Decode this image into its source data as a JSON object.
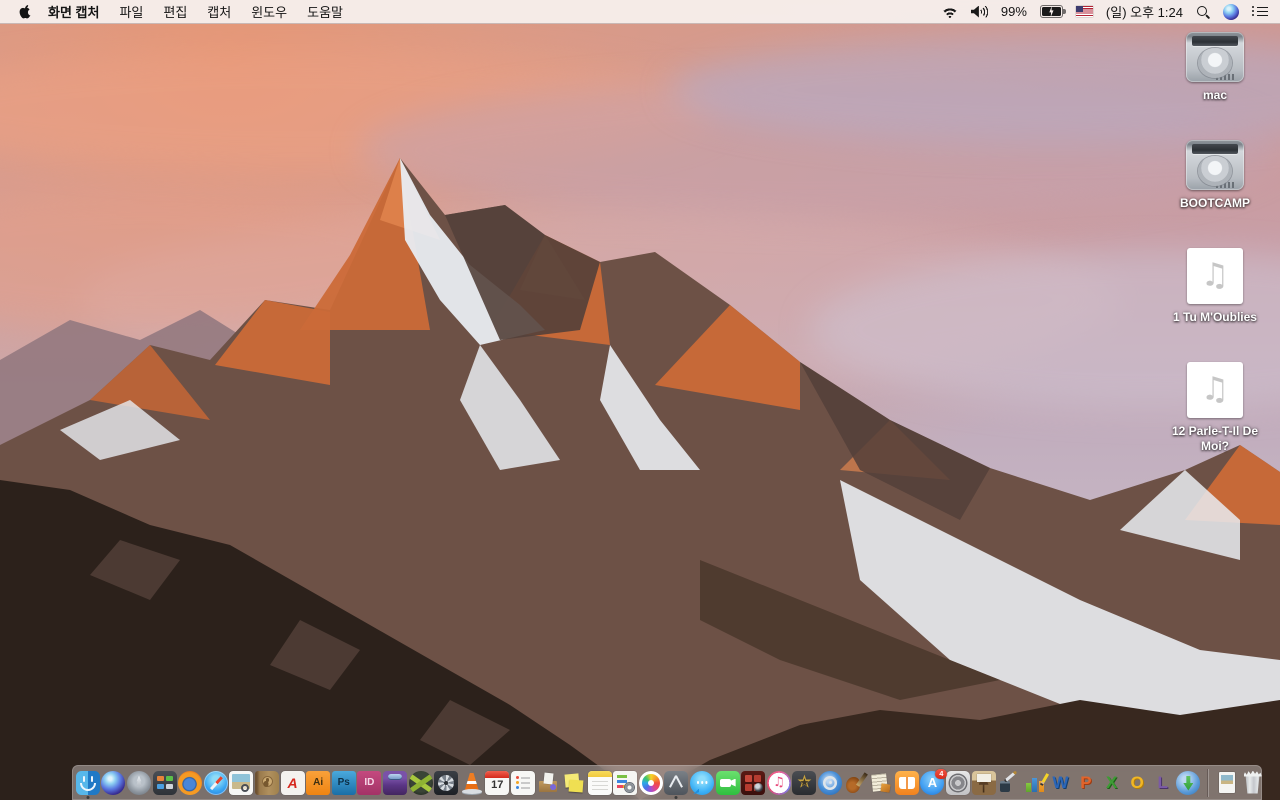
{
  "menu_bar": {
    "app_name": "화면 캡처",
    "menus": [
      "파일",
      "편집",
      "캡처",
      "윈도우",
      "도움말"
    ],
    "status": {
      "battery_percent": "99%",
      "clock": "(일) 오후 1:24"
    }
  },
  "desktop": {
    "icons": [
      {
        "name": "mac",
        "type": "drive",
        "label": "mac"
      },
      {
        "name": "bootcamp",
        "type": "drive",
        "label": "BOOTCAMP"
      },
      {
        "name": "audio-1",
        "type": "audio",
        "label": "1 Tu M'Oublies"
      },
      {
        "name": "audio-2",
        "type": "audio",
        "label": "12 Parle-T-Il De Moi?"
      }
    ]
  },
  "dock": {
    "apps": [
      {
        "name": "finder",
        "running": true
      },
      {
        "name": "siri"
      },
      {
        "name": "launchpad"
      },
      {
        "name": "mission-control"
      },
      {
        "name": "firefox"
      },
      {
        "name": "safari"
      },
      {
        "name": "preview"
      },
      {
        "name": "contacts"
      },
      {
        "name": "acrobat",
        "text": "A"
      },
      {
        "name": "illustrator",
        "text": "Ai"
      },
      {
        "name": "photoshop",
        "text": "Ps"
      },
      {
        "name": "indesign",
        "text": "ID"
      },
      {
        "name": "toast"
      },
      {
        "name": "xee"
      },
      {
        "name": "fan-utility"
      },
      {
        "name": "vlc"
      },
      {
        "name": "calendar",
        "text": "17"
      },
      {
        "name": "reminders"
      },
      {
        "name": "unarchiver"
      },
      {
        "name": "stickies"
      },
      {
        "name": "notes"
      },
      {
        "name": "gear-doc"
      },
      {
        "name": "photos"
      },
      {
        "name": "grab",
        "running": true
      },
      {
        "name": "messages"
      },
      {
        "name": "facetime"
      },
      {
        "name": "photo-booth"
      },
      {
        "name": "itunes"
      },
      {
        "name": "imovie"
      },
      {
        "name": "dvd-player"
      },
      {
        "name": "garageband"
      },
      {
        "name": "collage"
      },
      {
        "name": "ibooks"
      },
      {
        "name": "app-store",
        "text": "A",
        "badge": "4"
      },
      {
        "name": "system-preferences"
      },
      {
        "name": "keynote"
      },
      {
        "name": "pages"
      },
      {
        "name": "numbers"
      },
      {
        "name": "word",
        "text": "W"
      },
      {
        "name": "powerpoint",
        "text": "P"
      },
      {
        "name": "excel",
        "text": "X"
      },
      {
        "name": "outlook",
        "text": "O"
      },
      {
        "name": "lync",
        "text": "L"
      },
      {
        "name": "downloader"
      }
    ],
    "others": [
      {
        "name": "document"
      },
      {
        "name": "trash"
      }
    ]
  },
  "colors": {
    "menubar_bg": "#f6eeeb",
    "dock_bg": "rgba(200,192,190,0.5)",
    "badge_red": "#e8402a",
    "sky_pink": "#cf9790",
    "sky_lavender": "#c9bfcb",
    "rock_orange": "#cb6a38",
    "rock_shadow": "#53403a"
  }
}
